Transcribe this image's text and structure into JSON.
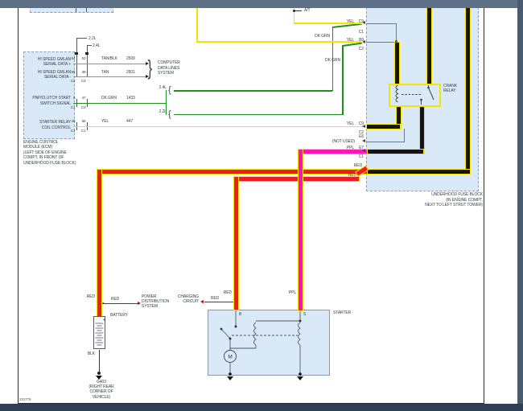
{
  "window": {
    "diagram_number": "231776"
  },
  "colors": {
    "yellow": "#f6e400",
    "dk_green": "#1f8f1f",
    "red": "#ec1c24",
    "purple": "#ff14b8",
    "tan": "#b08e5c",
    "panel_blue": "#d9e9f7",
    "top_bar": "#5e7086",
    "bottom_bar": "#2e3e54",
    "side_strip": "#4a5a70"
  },
  "glyphs": {
    "brace_close": "}",
    "brace_open": "{"
  },
  "top": {
    "yel_cut_1": "YEL",
    "yel_cut_2": "YEL",
    "at_label": "A/T"
  },
  "ecm": {
    "variant_callouts": {
      "v22": "2.2L",
      "v24": "2.4L"
    },
    "rows": [
      {
        "name1": "HI SPEED GMLAN",
        "name2": "SERIAL DATA +",
        "pin1": "64",
        "pin2": "53",
        "conn1": "",
        "conn2": "",
        "color": "TAN/BLK",
        "circuit": "2500"
      },
      {
        "name1": "HI SPEED GMLAN",
        "name2": "SERIAL DATA -",
        "pin1": "65",
        "pin2": "39",
        "conn1": "C2",
        "conn2": "C3",
        "color": "TAN",
        "circuit": "2501"
      },
      {
        "name1": "PNP/CLUTCH START",
        "name2": "SWITCH SIGNAL",
        "pin1": "6",
        "pin2": "47",
        "conn1": "C1",
        "conn2": "C3",
        "color": "DK GRN",
        "circuit": "1433"
      },
      {
        "name1": "STARTER RELAY",
        "name2": "COIL CONTROL",
        "pin1": "46",
        "pin2": "56",
        "conn1": "C1",
        "conn2": "C1",
        "color": "YEL",
        "circuit": "447"
      }
    ],
    "caption": [
      "ENGINE CONTROL",
      "MODULE (ECM)",
      "(LEFT SIDE OF ENGINE",
      "COMPT, IN FRONT OF",
      "UNDERHOOD FUSE BLOCK)"
    ]
  },
  "computer_data_lines": [
    "COMPUTER",
    "DATA LINES",
    "SYSTEM"
  ],
  "branch": {
    "v24": "2.4L",
    "v22": "2.2L",
    "dk_grn_1": "DK GRN",
    "dk_grn_2": "DK GRN"
  },
  "fuse_block": {
    "caption": [
      "UNDERHOOD FUSE BLOCK",
      "(IN ENGINE COMPT,",
      "NEXT TO LEFT STRUT TOWER)"
    ],
    "terminals": {
      "c9_top": {
        "wire": "YEL",
        "id": "C9",
        "conn": "C1"
      },
      "b9": {
        "wire": "YEL",
        "id": "B9",
        "conn": "C2"
      },
      "c9_low": {
        "wire": "YEL",
        "id": "C9",
        "conn": "C2"
      },
      "e6": {
        "id": "E6",
        "note": "(NOT USED)"
      },
      "e7": {
        "wire": "PPL",
        "id": "E7",
        "conn": "C1"
      },
      "red_upper": "RED",
      "red_lower": "RED"
    },
    "crank_relay": [
      "CRANK",
      "RELAY"
    ]
  },
  "power": {
    "red_battery": "RED",
    "red_thin_pd": "RED",
    "pd_system": [
      "POWER",
      "DISTRIBUTION",
      "SYSTEM"
    ],
    "battery": "BATTERY",
    "plus": "+",
    "blk": "BLK",
    "g403": [
      "G403",
      "(RIGHT REAR",
      "CORNER OF",
      "VEHICLE)"
    ],
    "red_charging_vert": "RED",
    "red_thin_chg": "RED",
    "charging": [
      "CHARGING",
      "CIRCUIT"
    ],
    "ppl": "PPL"
  },
  "starter": {
    "label": "STARTER",
    "b": "B",
    "s": "S",
    "motor": "M"
  }
}
